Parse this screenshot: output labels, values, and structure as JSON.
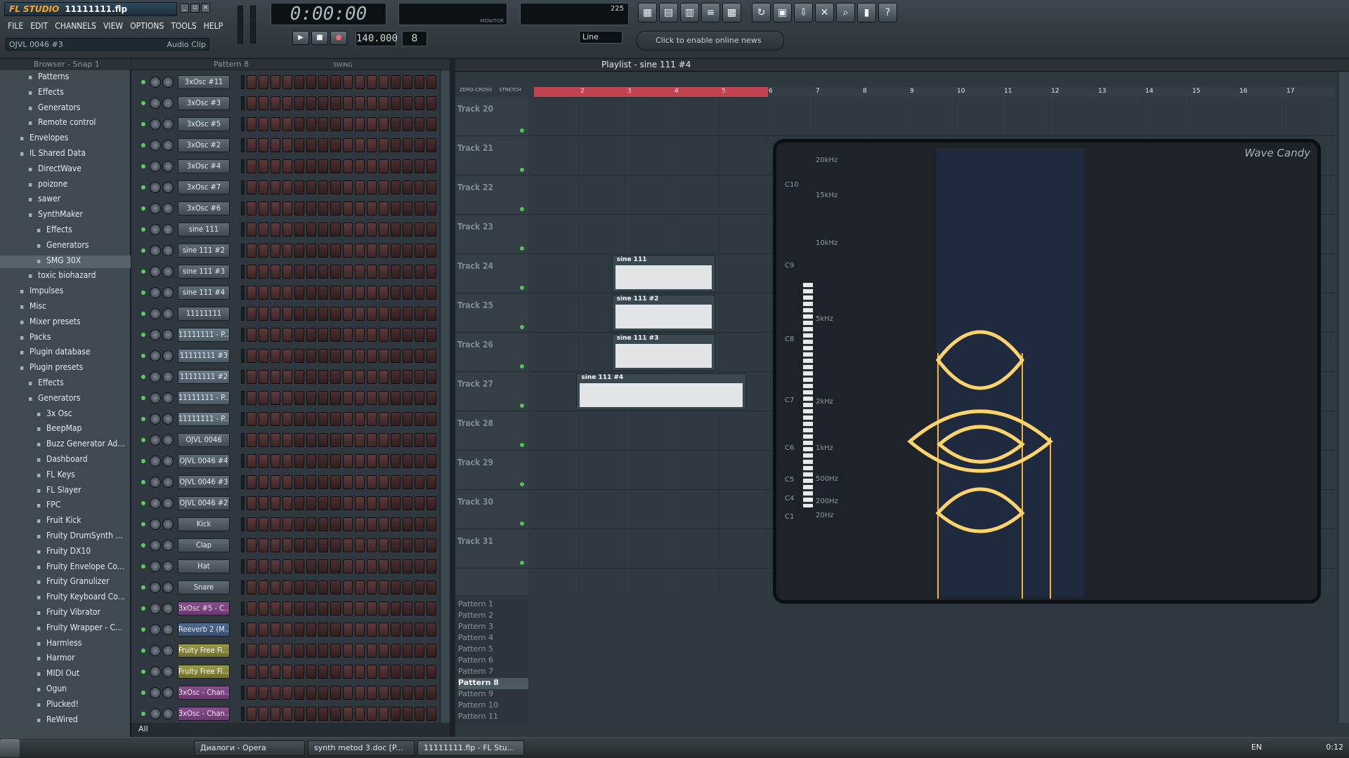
{
  "app": {
    "logo": "FL STUDIO",
    "file": "11111111.flp",
    "window_buttons": [
      "_",
      "▫",
      "×"
    ]
  },
  "menu": [
    "FILE",
    "EDIT",
    "CHANNELS",
    "VIEW",
    "OPTIONS",
    "TOOLS",
    "HELP"
  ],
  "hint": {
    "left": "OJVL 0046 #3",
    "right": "Audio Clip"
  },
  "transport": {
    "time": "0:00:00",
    "tempo": "140.000",
    "pattern": "8",
    "snap": "Line",
    "monitor_label": "MONITOR",
    "cpu_value": "225",
    "play": "▶",
    "stop": "■",
    "record": "●"
  },
  "news": "Click to enable online news",
  "toolbar_icons": [
    "playlist-icon",
    "step-sequencer-icon",
    "piano-roll-icon",
    "browser-icon",
    "mixer-icon",
    "undo-icon",
    "save-icon",
    "export-icon",
    "settings-icon",
    "tuner-icon",
    "info-icon",
    "help-icon"
  ],
  "toolbar_glyphs": [
    "▦",
    "▤",
    "▥",
    "≡",
    "▩",
    "↻",
    "▣",
    "⇩",
    "✕",
    "⌕",
    "▮",
    "?"
  ],
  "browser": {
    "header": "Browser - Snap 1",
    "items": [
      {
        "label": "Patterns",
        "indent": 1
      },
      {
        "label": "Effects",
        "indent": 1
      },
      {
        "label": "Generators",
        "indent": 1
      },
      {
        "label": "Remote control",
        "indent": 1
      },
      {
        "label": "Envelopes",
        "indent": 0
      },
      {
        "label": "IL Shared Data",
        "indent": 0
      },
      {
        "label": "DirectWave",
        "indent": 1
      },
      {
        "label": "poizone",
        "indent": 1
      },
      {
        "label": "sawer",
        "indent": 1
      },
      {
        "label": "SynthMaker",
        "indent": 1
      },
      {
        "label": "Effects",
        "indent": 2
      },
      {
        "label": "Generators",
        "indent": 2
      },
      {
        "label": "SMG 30X",
        "indent": 2,
        "sel": true
      },
      {
        "label": "toxic biohazard",
        "indent": 1
      },
      {
        "label": "Impulses",
        "indent": 0
      },
      {
        "label": "Misc",
        "indent": 0
      },
      {
        "label": "Mixer presets",
        "indent": 0
      },
      {
        "label": "Packs",
        "indent": 0
      },
      {
        "label": "Plugin database",
        "indent": 0
      },
      {
        "label": "Plugin presets",
        "indent": 0
      },
      {
        "label": "Effects",
        "indent": 1
      },
      {
        "label": "Generators",
        "indent": 1
      },
      {
        "label": "3x Osc",
        "indent": 2
      },
      {
        "label": "BeepMap",
        "indent": 2
      },
      {
        "label": "Buzz Generator Ad...",
        "indent": 2
      },
      {
        "label": "Dashboard",
        "indent": 2
      },
      {
        "label": "FL Keys",
        "indent": 2
      },
      {
        "label": "FL Slayer",
        "indent": 2
      },
      {
        "label": "FPC",
        "indent": 2
      },
      {
        "label": "Fruit Kick",
        "indent": 2
      },
      {
        "label": "Fruity DrumSynth ...",
        "indent": 2
      },
      {
        "label": "Fruity DX10",
        "indent": 2
      },
      {
        "label": "Fruity Envelope Co...",
        "indent": 2
      },
      {
        "label": "Fruity Granulizer",
        "indent": 2
      },
      {
        "label": "Fruity Keyboard Co...",
        "indent": 2
      },
      {
        "label": "Fruity Vibrator",
        "indent": 2
      },
      {
        "label": "Fruity Wrapper - C...",
        "indent": 2
      },
      {
        "label": "Harmless",
        "indent": 2
      },
      {
        "label": "Harmor",
        "indent": 2
      },
      {
        "label": "MIDI Out",
        "indent": 2
      },
      {
        "label": "Ogun",
        "indent": 2
      },
      {
        "label": "Plucked!",
        "indent": 2
      },
      {
        "label": "ReWired",
        "indent": 2
      }
    ]
  },
  "channel_rack": {
    "header": "Pattern 8",
    "swing": "SWING",
    "footer": "All",
    "channels": [
      {
        "name": "3xOsc #11",
        "style": ""
      },
      {
        "name": "3xOsc #3",
        "style": ""
      },
      {
        "name": "3xOsc #5",
        "style": ""
      },
      {
        "name": "3xOsc #2",
        "style": ""
      },
      {
        "name": "3xOsc #4",
        "style": ""
      },
      {
        "name": "3xOsc #7",
        "style": ""
      },
      {
        "name": "3xOsc #6",
        "style": ""
      },
      {
        "name": "sine 111",
        "style": ""
      },
      {
        "name": "sine 111 #2",
        "style": ""
      },
      {
        "name": "sine 111 #3",
        "style": ""
      },
      {
        "name": "sine 111 #4",
        "style": ""
      },
      {
        "name": "11111111",
        "style": ""
      },
      {
        "name": "11111111 - P...",
        "style": "pal"
      },
      {
        "name": "11111111 #3",
        "style": "pal"
      },
      {
        "name": "11111111 #2",
        "style": "pal"
      },
      {
        "name": "11111111 - P...",
        "style": "pal"
      },
      {
        "name": "11111111 - P...",
        "style": "pal"
      },
      {
        "name": "OJVL 0046",
        "style": ""
      },
      {
        "name": "OJVL 0046 #4",
        "style": ""
      },
      {
        "name": "OJVL 0046 #3",
        "style": ""
      },
      {
        "name": "OJVL 0046 #2",
        "style": ""
      },
      {
        "name": "Kick",
        "style": ""
      },
      {
        "name": "Clap",
        "style": ""
      },
      {
        "name": "Hat",
        "style": ""
      },
      {
        "name": "Snare",
        "style": ""
      },
      {
        "name": "3xOsc #5 - C...",
        "style": "pink"
      },
      {
        "name": "Reeverb 2 (M...",
        "style": "blue"
      },
      {
        "name": "Fruity Free Fi...",
        "style": "yellow"
      },
      {
        "name": "Fruity Free Fi...",
        "style": "yellow"
      },
      {
        "name": "3xOsc - Chan...",
        "style": "pink"
      },
      {
        "name": "3xOsc - Chan...",
        "style": "pink"
      }
    ]
  },
  "playlist": {
    "title": "Playlist - sine 111 #4",
    "opts": [
      "ZERO-CROSS",
      "STRETCH"
    ],
    "ruler": [
      "2",
      "3",
      "4",
      "5",
      "6",
      "7",
      "8",
      "9",
      "10",
      "11",
      "12",
      "13",
      "14",
      "15",
      "16",
      "17"
    ],
    "tracks": [
      "Track 20",
      "Track 21",
      "Track 22",
      "Track 23",
      "Track 24",
      "Track 25",
      "Track 26",
      "Track 27",
      "Track 28",
      "Track 29",
      "Track 30",
      "Track 31"
    ],
    "clips": [
      {
        "label": "sine 111",
        "track": 4,
        "bar_start": 2.8,
        "bar_len": 2.2
      },
      {
        "label": "sine 111 #2",
        "track": 5,
        "bar_start": 2.8,
        "bar_len": 2.2
      },
      {
        "label": "sine 111 #3",
        "track": 6,
        "bar_start": 2.8,
        "bar_len": 2.2
      },
      {
        "label": "sine 111 #4",
        "track": 7,
        "bar_start": 2.05,
        "bar_len": 3.6
      }
    ],
    "patterns": [
      "Pattern 1",
      "Pattern 2",
      "Pattern 3",
      "Pattern 4",
      "Pattern 5",
      "Pattern 6",
      "Pattern 7",
      "Pattern 8",
      "Pattern 9",
      "Pattern 10",
      "Pattern 11"
    ],
    "selected_pattern": "Pattern 8"
  },
  "wave_candy": {
    "title": "Wave Candy",
    "notes": [
      "C10",
      "C9",
      "C8",
      "C7",
      "C6",
      "C5",
      "C4",
      "C1"
    ],
    "freqs": [
      "20kHz",
      "15kHz",
      "10kHz",
      "5kHz",
      "2kHz",
      "1kHz",
      "500Hz",
      "200Hz",
      "20Hz"
    ]
  },
  "taskbar": {
    "tasks": [
      "Диалоги - Opera",
      "synth metod 3.doc [P...",
      "11111111.flp - FL Stu..."
    ],
    "lang": "EN",
    "clock": "0:12"
  },
  "colors": {
    "accent": "#f5a623",
    "loop": "#c0434f",
    "led": "#5ad05a"
  }
}
